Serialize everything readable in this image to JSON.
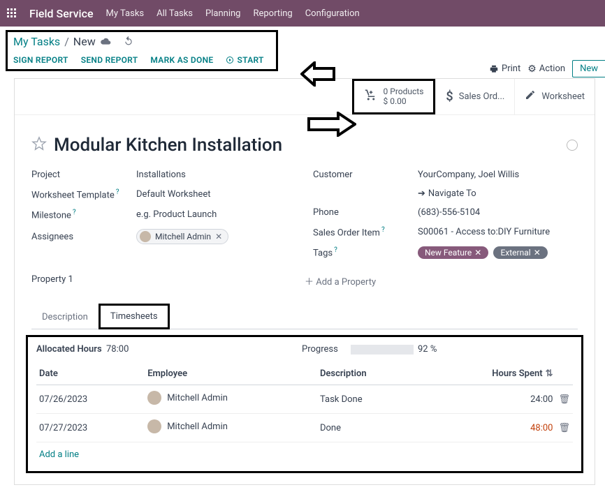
{
  "nav": {
    "brand": "Field Service",
    "links": [
      "My Tasks",
      "All Tasks",
      "Planning",
      "Reporting",
      "Configuration"
    ]
  },
  "breadcrumb": {
    "root": "My Tasks",
    "current": "New"
  },
  "actions": {
    "sign": "SIGN REPORT",
    "send": "SEND REPORT",
    "done": "MARK AS DONE",
    "start": "START"
  },
  "topright": {
    "print": "Print",
    "action": "Action",
    "new": "New"
  },
  "stats": {
    "products": {
      "line1": "0 Products",
      "line2": "$ 0.00"
    },
    "sales": "Sales Ord...",
    "worksheet": "Worksheet"
  },
  "title": "Modular Kitchen Installation",
  "left_fields": {
    "project": {
      "label": "Project",
      "value": "Installations"
    },
    "template": {
      "label": "Worksheet Template",
      "value": "Default Worksheet"
    },
    "milestone": {
      "label": "Milestone",
      "placeholder": "e.g. Product Launch"
    },
    "assignees": {
      "label": "Assignees",
      "chip": "Mitchell Admin"
    }
  },
  "right_fields": {
    "customer": {
      "label": "Customer",
      "value": "YourCompany, Joel Willis"
    },
    "navigate": "Navigate To",
    "phone": {
      "label": "Phone",
      "value": "(683)-556-5104"
    },
    "soitem": {
      "label": "Sales Order Item",
      "value": "S00061 - Access to:DIY Furniture"
    },
    "tags": {
      "label": "Tags",
      "t1": "New Feature",
      "t2": "External"
    }
  },
  "property": {
    "label": "Property 1",
    "add": "Add a Property"
  },
  "tabs": {
    "desc": "Description",
    "ts": "Timesheets"
  },
  "alloc": {
    "label": "Allocated Hours",
    "value": "78:00",
    "progress_label": "Progress",
    "progress_pct": "92 %",
    "progress_fill": 92
  },
  "ts_head": {
    "date": "Date",
    "emp": "Employee",
    "desc": "Description",
    "hrs": "Hours Spent"
  },
  "ts_rows": [
    {
      "date": "07/26/2023",
      "emp": "Mitchell Admin",
      "desc": "Task Done",
      "hrs": "24:00",
      "orange": false
    },
    {
      "date": "07/27/2023",
      "emp": "Mitchell Admin",
      "desc": "Done",
      "hrs": "48:00",
      "orange": true
    }
  ],
  "addline": "Add a line"
}
